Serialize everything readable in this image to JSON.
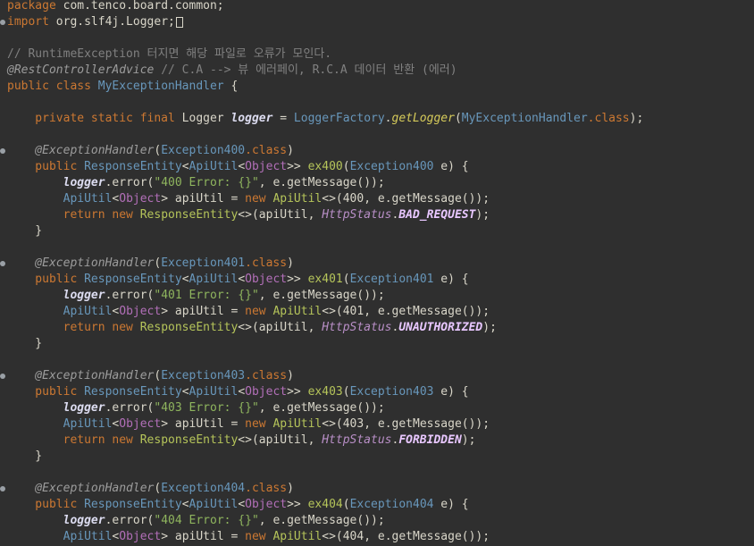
{
  "editor": {
    "lines": [
      [
        {
          "t": "package",
          "c": "kw"
        },
        {
          "t": " com.tenco.board.common;",
          "c": "plain"
        }
      ],
      [
        {
          "t": "import",
          "c": "kw"
        },
        {
          "t": " org.slf4j.Logger;",
          "c": "plain"
        },
        {
          "t": "",
          "c": "box"
        }
      ],
      [],
      [
        {
          "t": "// RuntimeException 터지면 해당 파일로 오류가 모인다.",
          "c": "cmt"
        }
      ],
      [
        {
          "t": "@RestControllerAdvice",
          "c": "ann"
        },
        {
          "t": " // C.A --> 뷰 에러페이, R.C.A 데이터 반환 (에러)",
          "c": "cmt"
        }
      ],
      [
        {
          "t": "public class",
          "c": "kw"
        },
        {
          "t": " ",
          "c": "plain"
        },
        {
          "t": "MyExceptionHandler",
          "c": "type"
        },
        {
          "t": " {",
          "c": "plain"
        }
      ],
      [],
      [
        {
          "t": "    private static final",
          "c": "kw"
        },
        {
          "t": " Logger ",
          "c": "plain"
        },
        {
          "t": "logger",
          "c": "field"
        },
        {
          "t": " = ",
          "c": "plain"
        },
        {
          "t": "LoggerFactory",
          "c": "type"
        },
        {
          "t": ".",
          "c": "plain"
        },
        {
          "t": "getLogger",
          "c": "method-it"
        },
        {
          "t": "(",
          "c": "plain"
        },
        {
          "t": "MyExceptionHandler",
          "c": "type"
        },
        {
          "t": ".class",
          "c": "kw"
        },
        {
          "t": ");",
          "c": "plain"
        }
      ],
      [],
      [
        {
          "t": "    @ExceptionHandler",
          "c": "ann"
        },
        {
          "t": "(",
          "c": "plain"
        },
        {
          "t": "Exception400",
          "c": "type"
        },
        {
          "t": ".class",
          "c": "kw"
        },
        {
          "t": ")",
          "c": "plain"
        }
      ],
      [
        {
          "t": "    public",
          "c": "kw"
        },
        {
          "t": " ",
          "c": "plain"
        },
        {
          "t": "ResponseEntity",
          "c": "type"
        },
        {
          "t": "<",
          "c": "plain"
        },
        {
          "t": "ApiUtil",
          "c": "type"
        },
        {
          "t": "<",
          "c": "plain"
        },
        {
          "t": "Object",
          "c": "tgen"
        },
        {
          "t": ">> ",
          "c": "plain"
        },
        {
          "t": "ex400",
          "c": "method"
        },
        {
          "t": "(",
          "c": "plain"
        },
        {
          "t": "Exception400",
          "c": "type"
        },
        {
          "t": " e) {",
          "c": "plain"
        }
      ],
      [
        {
          "t": "        ",
          "c": "plain"
        },
        {
          "t": "logger",
          "c": "field"
        },
        {
          "t": ".error(",
          "c": "plain"
        },
        {
          "t": "\"400 Error: {}\"",
          "c": "str"
        },
        {
          "t": ", e.getMessage());",
          "c": "plain"
        }
      ],
      [
        {
          "t": "        ",
          "c": "plain"
        },
        {
          "t": "ApiUtil",
          "c": "type"
        },
        {
          "t": "<",
          "c": "plain"
        },
        {
          "t": "Object",
          "c": "tgen"
        },
        {
          "t": "> apiUtil = ",
          "c": "plain"
        },
        {
          "t": "new",
          "c": "kw"
        },
        {
          "t": " ",
          "c": "plain"
        },
        {
          "t": "ApiUtil",
          "c": "method"
        },
        {
          "t": "<>(400, e.getMessage());",
          "c": "plain"
        }
      ],
      [
        {
          "t": "        return new",
          "c": "kw"
        },
        {
          "t": " ",
          "c": "plain"
        },
        {
          "t": "ResponseEntity",
          "c": "method"
        },
        {
          "t": "<>(apiUtil, ",
          "c": "plain"
        },
        {
          "t": "HttpStatus",
          "c": "statcls"
        },
        {
          "t": ".",
          "c": "plain"
        },
        {
          "t": "BAD_REQUEST",
          "c": "enumval"
        },
        {
          "t": ");",
          "c": "plain"
        }
      ],
      [
        {
          "t": "    }",
          "c": "plain"
        }
      ],
      [],
      [
        {
          "t": "    @ExceptionHandler",
          "c": "ann"
        },
        {
          "t": "(",
          "c": "plain"
        },
        {
          "t": "Exception401",
          "c": "type"
        },
        {
          "t": ".class",
          "c": "kw"
        },
        {
          "t": ")",
          "c": "plain"
        }
      ],
      [
        {
          "t": "    public",
          "c": "kw"
        },
        {
          "t": " ",
          "c": "plain"
        },
        {
          "t": "ResponseEntity",
          "c": "type"
        },
        {
          "t": "<",
          "c": "plain"
        },
        {
          "t": "ApiUtil",
          "c": "type"
        },
        {
          "t": "<",
          "c": "plain"
        },
        {
          "t": "Object",
          "c": "tgen"
        },
        {
          "t": ">> ",
          "c": "plain"
        },
        {
          "t": "ex401",
          "c": "method"
        },
        {
          "t": "(",
          "c": "plain"
        },
        {
          "t": "Exception401",
          "c": "type"
        },
        {
          "t": " e) {",
          "c": "plain"
        }
      ],
      [
        {
          "t": "        ",
          "c": "plain"
        },
        {
          "t": "logger",
          "c": "field"
        },
        {
          "t": ".error(",
          "c": "plain"
        },
        {
          "t": "\"401 Error: {}\"",
          "c": "str"
        },
        {
          "t": ", e.getMessage());",
          "c": "plain"
        }
      ],
      [
        {
          "t": "        ",
          "c": "plain"
        },
        {
          "t": "ApiUtil",
          "c": "type"
        },
        {
          "t": "<",
          "c": "plain"
        },
        {
          "t": "Object",
          "c": "tgen"
        },
        {
          "t": "> apiUtil = ",
          "c": "plain"
        },
        {
          "t": "new",
          "c": "kw"
        },
        {
          "t": " ",
          "c": "plain"
        },
        {
          "t": "ApiUtil",
          "c": "method"
        },
        {
          "t": "<>(401, e.getMessage());",
          "c": "plain"
        }
      ],
      [
        {
          "t": "        return new",
          "c": "kw"
        },
        {
          "t": " ",
          "c": "plain"
        },
        {
          "t": "ResponseEntity",
          "c": "method"
        },
        {
          "t": "<>(apiUtil, ",
          "c": "plain"
        },
        {
          "t": "HttpStatus",
          "c": "statcls"
        },
        {
          "t": ".",
          "c": "plain"
        },
        {
          "t": "UNAUTHORIZED",
          "c": "enumval"
        },
        {
          "t": ");",
          "c": "plain"
        }
      ],
      [
        {
          "t": "    }",
          "c": "plain"
        }
      ],
      [],
      [
        {
          "t": "    @ExceptionHandler",
          "c": "ann"
        },
        {
          "t": "(",
          "c": "plain"
        },
        {
          "t": "Exception403",
          "c": "type"
        },
        {
          "t": ".class",
          "c": "kw"
        },
        {
          "t": ")",
          "c": "plain"
        }
      ],
      [
        {
          "t": "    public",
          "c": "kw"
        },
        {
          "t": " ",
          "c": "plain"
        },
        {
          "t": "ResponseEntity",
          "c": "type"
        },
        {
          "t": "<",
          "c": "plain"
        },
        {
          "t": "ApiUtil",
          "c": "type"
        },
        {
          "t": "<",
          "c": "plain"
        },
        {
          "t": "Object",
          "c": "tgen"
        },
        {
          "t": ">> ",
          "c": "plain"
        },
        {
          "t": "ex403",
          "c": "method"
        },
        {
          "t": "(",
          "c": "plain"
        },
        {
          "t": "Exception403",
          "c": "type"
        },
        {
          "t": " e) {",
          "c": "plain"
        }
      ],
      [
        {
          "t": "        ",
          "c": "plain"
        },
        {
          "t": "logger",
          "c": "field"
        },
        {
          "t": ".error(",
          "c": "plain"
        },
        {
          "t": "\"403 Error: {}\"",
          "c": "str"
        },
        {
          "t": ", e.getMessage());",
          "c": "plain"
        }
      ],
      [
        {
          "t": "        ",
          "c": "plain"
        },
        {
          "t": "ApiUtil",
          "c": "type"
        },
        {
          "t": "<",
          "c": "plain"
        },
        {
          "t": "Object",
          "c": "tgen"
        },
        {
          "t": "> apiUtil = ",
          "c": "plain"
        },
        {
          "t": "new",
          "c": "kw"
        },
        {
          "t": " ",
          "c": "plain"
        },
        {
          "t": "ApiUtil",
          "c": "method"
        },
        {
          "t": "<>(403, e.getMessage());",
          "c": "plain"
        }
      ],
      [
        {
          "t": "        return new",
          "c": "kw"
        },
        {
          "t": " ",
          "c": "plain"
        },
        {
          "t": "ResponseEntity",
          "c": "method"
        },
        {
          "t": "<>(apiUtil, ",
          "c": "plain"
        },
        {
          "t": "HttpStatus",
          "c": "statcls"
        },
        {
          "t": ".",
          "c": "plain"
        },
        {
          "t": "FORBIDDEN",
          "c": "enumval"
        },
        {
          "t": ");",
          "c": "plain"
        }
      ],
      [
        {
          "t": "    }",
          "c": "plain"
        }
      ],
      [],
      [
        {
          "t": "    @ExceptionHandler",
          "c": "ann"
        },
        {
          "t": "(",
          "c": "plain"
        },
        {
          "t": "Exception404",
          "c": "type"
        },
        {
          "t": ".class",
          "c": "kw"
        },
        {
          "t": ")",
          "c": "plain"
        }
      ],
      [
        {
          "t": "    public",
          "c": "kw"
        },
        {
          "t": " ",
          "c": "plain"
        },
        {
          "t": "ResponseEntity",
          "c": "type"
        },
        {
          "t": "<",
          "c": "plain"
        },
        {
          "t": "ApiUtil",
          "c": "type"
        },
        {
          "t": "<",
          "c": "plain"
        },
        {
          "t": "Object",
          "c": "tgen"
        },
        {
          "t": ">> ",
          "c": "plain"
        },
        {
          "t": "ex404",
          "c": "method"
        },
        {
          "t": "(",
          "c": "plain"
        },
        {
          "t": "Exception404",
          "c": "type"
        },
        {
          "t": " e) {",
          "c": "plain"
        }
      ],
      [
        {
          "t": "        ",
          "c": "plain"
        },
        {
          "t": "logger",
          "c": "field"
        },
        {
          "t": ".error(",
          "c": "plain"
        },
        {
          "t": "\"404 Error: {}\"",
          "c": "str"
        },
        {
          "t": ", e.getMessage());",
          "c": "plain"
        }
      ],
      [
        {
          "t": "        ",
          "c": "plain"
        },
        {
          "t": "ApiUtil",
          "c": "type"
        },
        {
          "t": "<",
          "c": "plain"
        },
        {
          "t": "Object",
          "c": "tgen"
        },
        {
          "t": "> apiUtil = ",
          "c": "plain"
        },
        {
          "t": "new",
          "c": "kw"
        },
        {
          "t": " ",
          "c": "plain"
        },
        {
          "t": "ApiUtil",
          "c": "method"
        },
        {
          "t": "<>(404, e.getMessage());",
          "c": "plain"
        }
      ]
    ],
    "gutter_markers": [
      {
        "line": 1,
        "icon": "fold-marker-icon"
      },
      {
        "line": 9,
        "icon": "breakpoint-marker-icon"
      },
      {
        "line": 16,
        "icon": "breakpoint-marker-icon"
      },
      {
        "line": 23,
        "icon": "breakpoint-marker-icon"
      },
      {
        "line": 30,
        "icon": "breakpoint-marker-icon"
      }
    ]
  },
  "colors": {
    "background": "#2f2f2f",
    "keyword": "#cc7832",
    "type": "#6897bb",
    "generic": "#b26fb8",
    "string": "#8fb55e",
    "method": "#b5c45a",
    "comment": "#808080"
  }
}
